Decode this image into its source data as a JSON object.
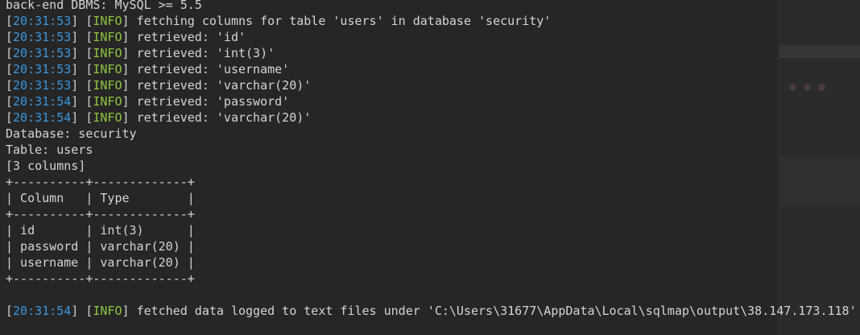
{
  "colors": {
    "background": "#262626",
    "text": "#d4d4d4",
    "timestamp": "#3a96dd",
    "info_level": "#8cc540"
  },
  "lines": [
    {
      "type": "text",
      "text": "back-end DBMS: MySQL >= 5.5"
    },
    {
      "type": "log",
      "time": "20:31:53",
      "level": "INFO",
      "message": "fetching columns for table 'users' in database 'security'"
    },
    {
      "type": "log",
      "time": "20:31:53",
      "level": "INFO",
      "message": "retrieved: 'id'"
    },
    {
      "type": "log",
      "time": "20:31:53",
      "level": "INFO",
      "message": "retrieved: 'int(3)'"
    },
    {
      "type": "log",
      "time": "20:31:53",
      "level": "INFO",
      "message": "retrieved: 'username'"
    },
    {
      "type": "log",
      "time": "20:31:53",
      "level": "INFO",
      "message": "retrieved: 'varchar(20)'"
    },
    {
      "type": "log",
      "time": "20:31:54",
      "level": "INFO",
      "message": "retrieved: 'password'"
    },
    {
      "type": "log",
      "time": "20:31:54",
      "level": "INFO",
      "message": "retrieved: 'varchar(20)'"
    },
    {
      "type": "text",
      "text": "Database: security"
    },
    {
      "type": "text",
      "text": "Table: users"
    },
    {
      "type": "text",
      "text": "[3 columns]"
    },
    {
      "type": "text",
      "text": "+----------+-------------+"
    },
    {
      "type": "text",
      "text": "| Column   | Type        |"
    },
    {
      "type": "text",
      "text": "+----------+-------------+"
    },
    {
      "type": "text",
      "text": "| id       | int(3)      |"
    },
    {
      "type": "text",
      "text": "| password | varchar(20) |"
    },
    {
      "type": "text",
      "text": "| username | varchar(20) |"
    },
    {
      "type": "text",
      "text": "+----------+-------------+"
    },
    {
      "type": "text",
      "text": ""
    },
    {
      "type": "log",
      "time": "20:31:54",
      "level": "INFO",
      "message": "fetched data logged to text files under 'C:\\Users\\31677\\AppData\\Local\\sqlmap\\output\\38.147.173.118'"
    }
  ]
}
